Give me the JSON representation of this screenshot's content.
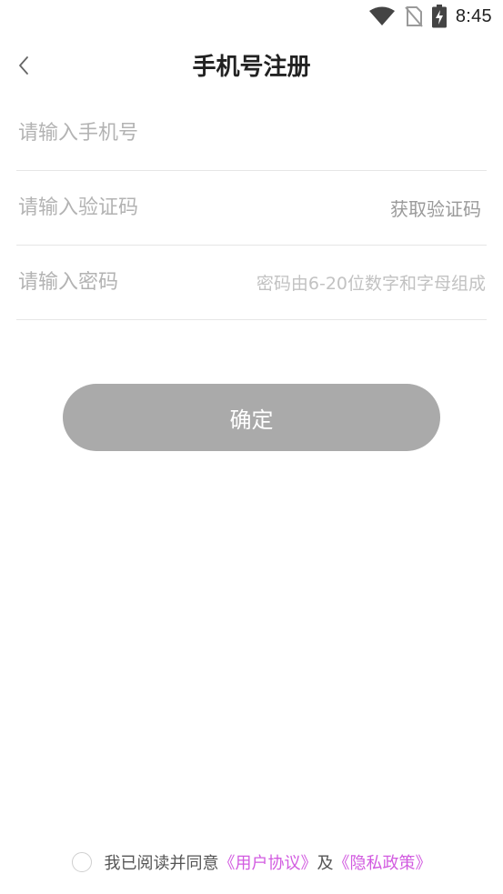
{
  "status_bar": {
    "time": "8:45",
    "icons": [
      "wifi-icon",
      "no-sim-icon",
      "battery-charging-icon"
    ]
  },
  "header": {
    "title": "手机号注册",
    "back_icon": "chevron-left-icon"
  },
  "form": {
    "phone": {
      "placeholder": "请输入手机号",
      "value": ""
    },
    "code": {
      "placeholder": "请输入验证码",
      "value": "",
      "get_code_label": "获取验证码"
    },
    "password": {
      "placeholder": "请输入密码",
      "value": "",
      "hint": "密码由6-20位数字和字母组成"
    }
  },
  "confirm": {
    "label": "确定",
    "color": "#aaaaaa"
  },
  "agreement": {
    "checked": false,
    "prefix": "我已阅读并同意",
    "user_agreement": "《用户协议》",
    "conjunction": "及",
    "privacy_policy": "《隐私政策》",
    "link_color": "#d25be0"
  }
}
